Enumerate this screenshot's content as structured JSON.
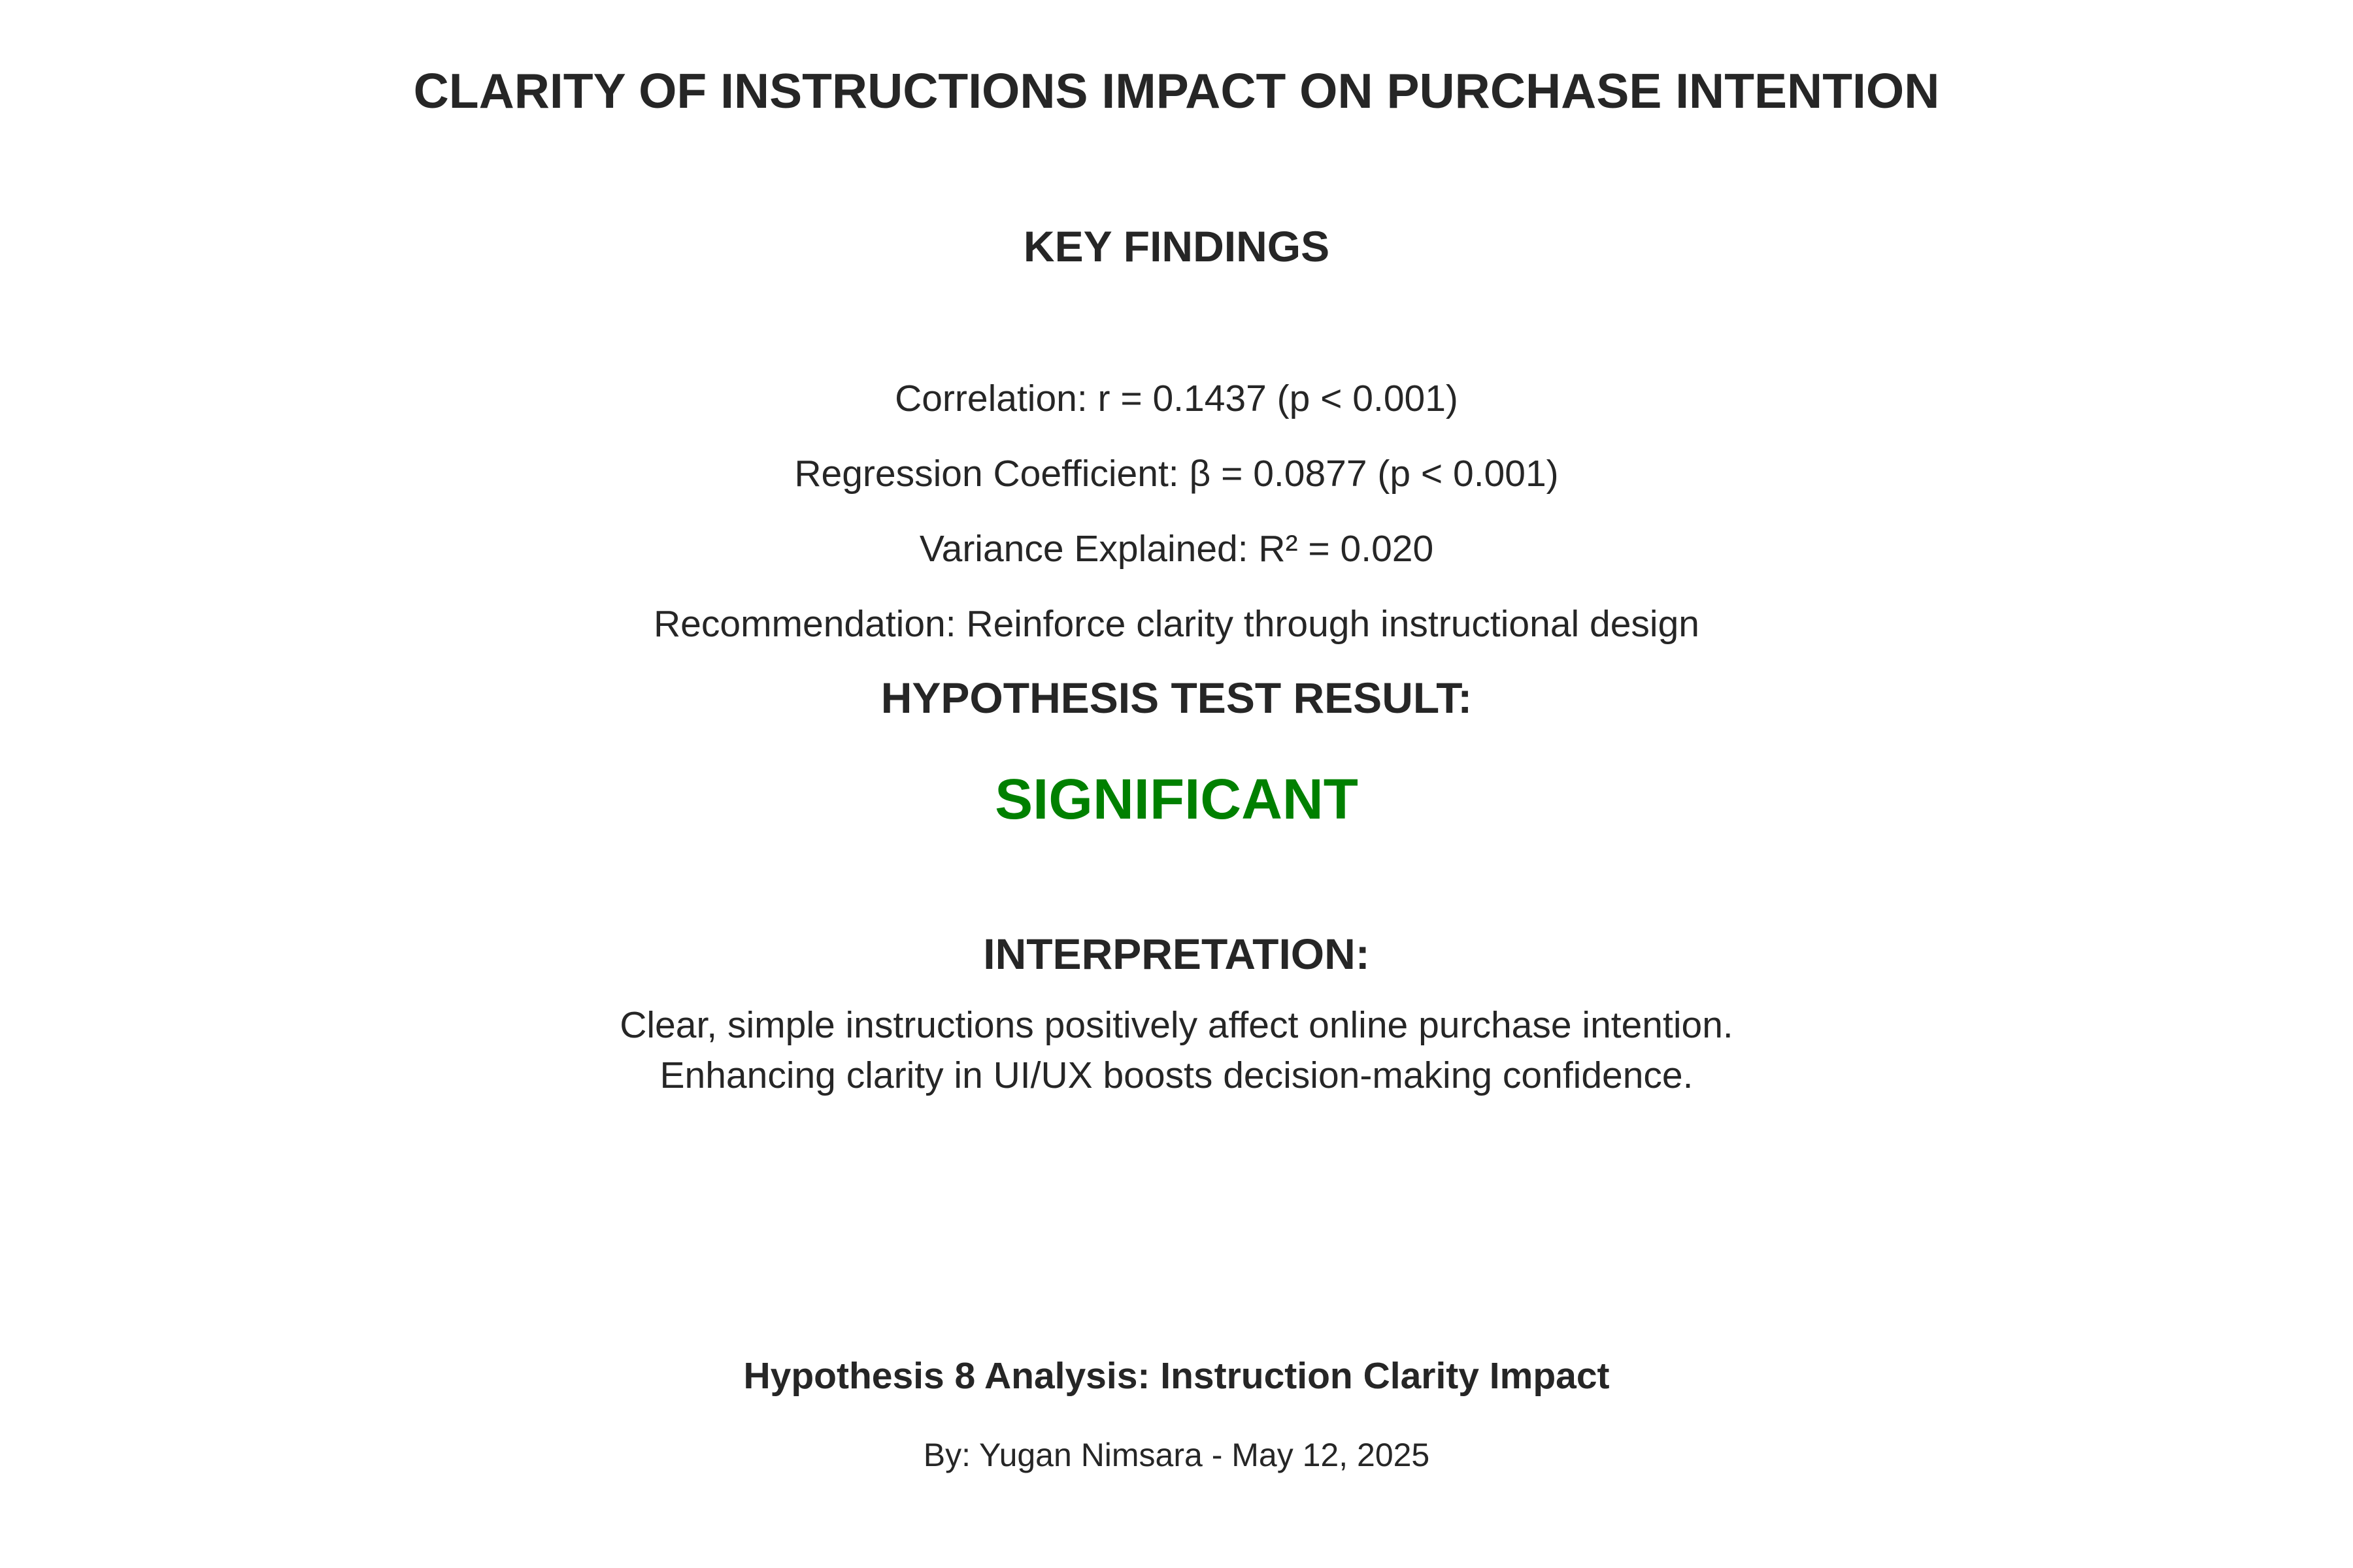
{
  "title": "CLARITY OF INSTRUCTIONS IMPACT ON PURCHASE INTENTION",
  "key_findings": {
    "heading": "KEY FINDINGS",
    "items": [
      "Correlation: r = 0.1437 (p < 0.001)",
      "Regression Coefficient: β = 0.0877 (p < 0.001)",
      "Variance Explained: R² = 0.020",
      "Recommendation: Reinforce clarity through instructional design"
    ]
  },
  "hypothesis_test": {
    "heading": "HYPOTHESIS TEST RESULT:",
    "result": "SIGNIFICANT",
    "result_color": "#008000"
  },
  "interpretation": {
    "heading": "INTERPRETATION:",
    "lines": [
      "Clear, simple instructions positively affect online purchase intention.",
      "Enhancing clarity in UI/UX boosts decision-making confidence."
    ]
  },
  "footer": {
    "title": "Hypothesis 8 Analysis: Instruction Clarity Impact",
    "author_line": "By: Yugan Nimsara - May 12, 2025"
  }
}
